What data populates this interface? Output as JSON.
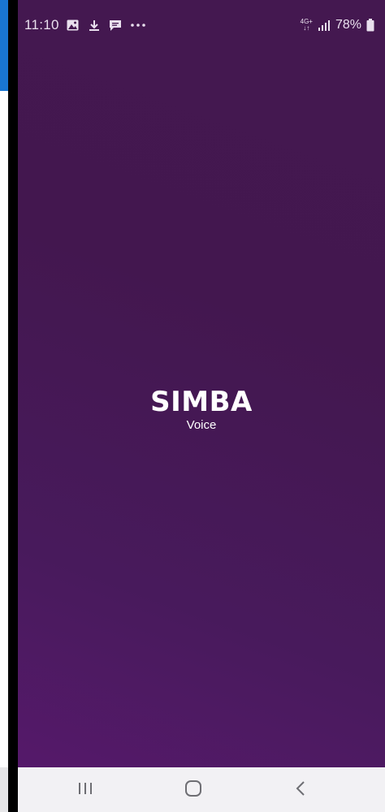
{
  "status_bar": {
    "time": "11:10",
    "notifications": [
      "image-icon",
      "download-icon",
      "message-icon",
      "more-dots-icon"
    ],
    "network_type_top": "4G+",
    "network_type_bottom": "↓↑",
    "battery": "78%"
  },
  "splash": {
    "brand": "SIMBA",
    "subtitle": "Voice"
  },
  "nav_bar": {
    "buttons": [
      "recent-apps-icon",
      "home-icon",
      "back-icon"
    ]
  },
  "colors": {
    "background": "#43174f",
    "status_text": "#e9e0ee",
    "nav_bar": "#f2f1f4",
    "left_accent": "#1976d2"
  }
}
